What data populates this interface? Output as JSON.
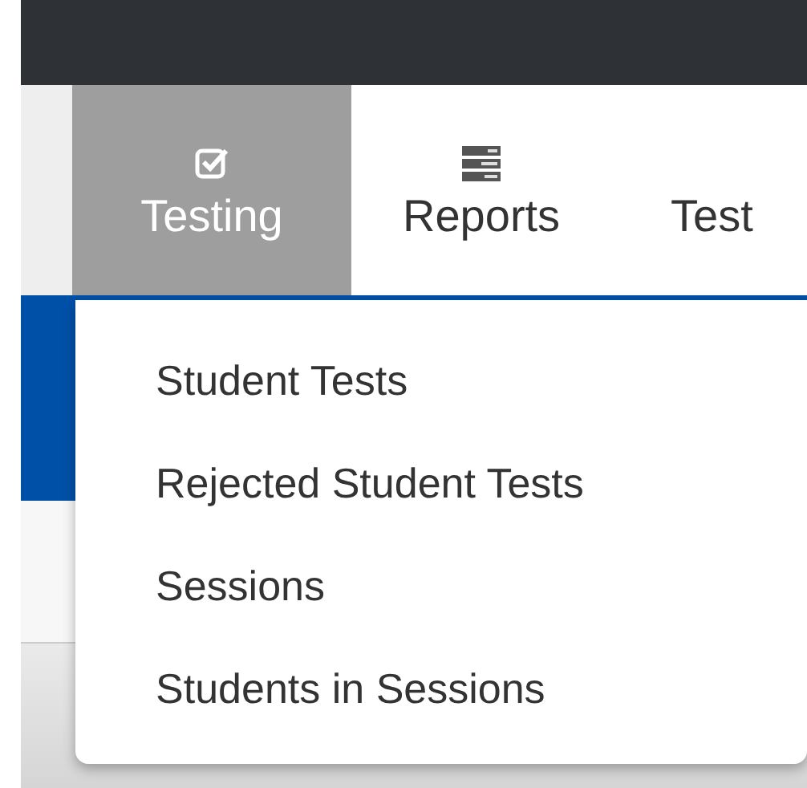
{
  "nav": {
    "tabs": [
      {
        "label": "Testing",
        "selected": true
      },
      {
        "label": "Reports",
        "selected": false
      },
      {
        "label": "Test",
        "selected": false
      }
    ]
  },
  "dropdown": {
    "items": [
      {
        "label": "Student Tests"
      },
      {
        "label": "Rejected Student Tests"
      },
      {
        "label": "Sessions"
      },
      {
        "label": "Students in Sessions"
      }
    ]
  }
}
